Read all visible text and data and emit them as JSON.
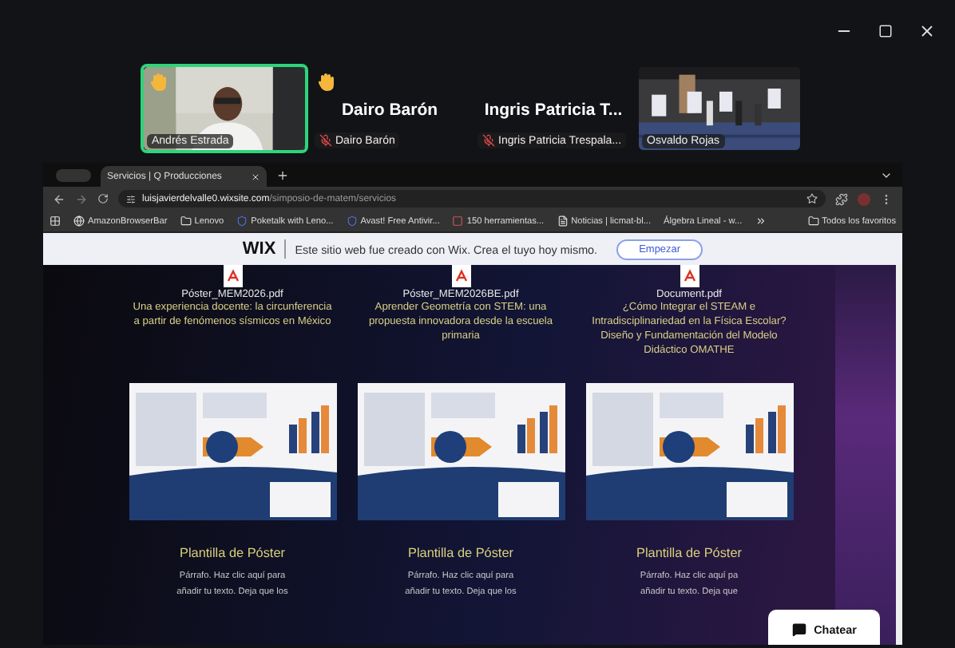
{
  "participants": [
    {
      "kind": "video",
      "label": "Andrés Estrada",
      "hand_raised": true,
      "speaking": true,
      "muted": false
    },
    {
      "kind": "avatar",
      "title": "Dairo Barón",
      "label": "Dairo Barón",
      "hand_raised": true,
      "speaking": false,
      "muted": true
    },
    {
      "kind": "avatar",
      "title": "Ingris Patricia T...",
      "label": "Ingris Patricia Trespala...",
      "hand_raised": false,
      "speaking": false,
      "muted": true
    },
    {
      "kind": "video",
      "label": "Osvaldo Rojas",
      "hand_raised": false,
      "speaking": false,
      "muted": false
    }
  ],
  "browser": {
    "tab": "Servicios | Q Producciones",
    "url_host": "luisjavierdelvalle0.wixsite.com",
    "url_path": "/simposio-de-matem/servicios",
    "bookmarks": [
      {
        "kind": "globe",
        "label": "AmazonBrowserBar"
      },
      {
        "kind": "folder",
        "label": "Lenovo"
      },
      {
        "kind": "shield",
        "label": "Poketalk with Leno..."
      },
      {
        "kind": "shield",
        "label": "Avast! Free Antivir..."
      },
      {
        "kind": "site",
        "label": "150 herramientas..."
      },
      {
        "kind": "page",
        "label": "Noticias | licmat-bl..."
      },
      {
        "kind": "none",
        "label": "Álgebra Lineal - w..."
      }
    ],
    "all_bookmarks": "Todos los favoritos"
  },
  "wix_banner": {
    "logo": "WIX",
    "text": "Este sitio web fue creado con Wix. Crea el tuyo hoy mismo.",
    "button": "Empezar"
  },
  "cards": [
    {
      "file": "Póster_MEM2026.pdf",
      "title": "Una experiencia docente: la circunferencia a partir  de fenómenos sísmicos en México",
      "heading": "Plantilla de Póster",
      "body": [
        "Párrafo. Haz clic aquí para",
        "añadir tu texto. Deja que los"
      ]
    },
    {
      "file": "Póster_MEM2026BE.pdf",
      "title": "Aprender Geometría con STEM: una propuesta innovadora desde la escuela primaria",
      "heading": "Plantilla de Póster",
      "body": [
        "Párrafo. Haz clic aquí para",
        "añadir tu texto. Deja que los"
      ]
    },
    {
      "file": "Document.pdf",
      "title": "¿Cómo Integrar el STEAM e Intradisciplinariedad en la Física Escolar? Diseño y Fundamentación del Modelo Didáctico OMATHE",
      "heading": "Plantilla de Póster",
      "body": [
        "Párrafo. Haz clic aquí pa",
        "añadir tu texto. Deja que"
      ]
    }
  ],
  "chat_button": "Chatear"
}
